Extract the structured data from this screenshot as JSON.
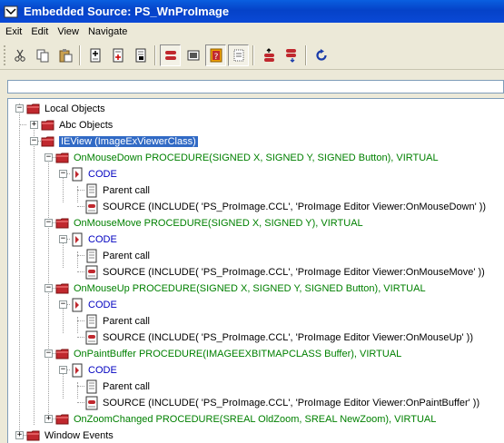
{
  "window": {
    "title": "Embedded Source: PS_WnProImage"
  },
  "menu": {
    "items": [
      "Exit",
      "Edit",
      "View",
      "Navigate"
    ]
  },
  "colors": {
    "titlebar": "#0542c8",
    "procedure_text": "#008000",
    "code_text": "#0000c0",
    "selection": "#316ac5",
    "folder_red": "#c0282e"
  },
  "tree": {
    "local_objects": "Local Objects",
    "abc_objects": "Abc Objects",
    "ieview": "IEView (ImageExViewerClass)",
    "on_mouse_down": "OnMouseDown PROCEDURE(SIGNED X, SIGNED Y, SIGNED Button), VIRTUAL",
    "on_mouse_move": "OnMouseMove PROCEDURE(SIGNED X, SIGNED Y), VIRTUAL",
    "on_mouse_up": "OnMouseUp PROCEDURE(SIGNED X, SIGNED Y, SIGNED Button), VIRTUAL",
    "on_paint_buffer": "OnPaintBuffer PROCEDURE(IMAGEEXBITMAPCLASS Buffer), VIRTUAL",
    "on_zoom_changed": "OnZoomChanged PROCEDURE(SREAL OldZoom, SREAL NewZoom), VIRTUAL",
    "window_events": "Window Events",
    "code": "CODE",
    "parent_call": "Parent call",
    "source_mouse_down": "SOURCE (INCLUDE( 'PS_ProImage.CCL', 'ProImage Editor Viewer:OnMouseDown' ))",
    "source_mouse_move": "SOURCE (INCLUDE( 'PS_ProImage.CCL', 'ProImage Editor Viewer:OnMouseMove' ))",
    "source_mouse_up": "SOURCE (INCLUDE( 'PS_ProImage.CCL', 'ProImage Editor Viewer:OnMouseUp' ))",
    "source_paint_buffer": "SOURCE (INCLUDE( 'PS_ProImage.CCL', 'ProImage Editor Viewer:OnPaintBuffer' ))"
  }
}
